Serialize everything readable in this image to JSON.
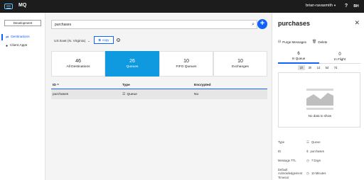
{
  "app": {
    "title": "MQ",
    "account": "brian-ravasmith",
    "avatar": "BH"
  },
  "sidebar": {
    "environment_button": "Development",
    "items": [
      {
        "label": "Destinations",
        "icon": "destinations-icon",
        "active": true
      },
      {
        "label": "Client Apps",
        "icon": "client-apps-icon",
        "active": false
      }
    ]
  },
  "main": {
    "search": {
      "value": "purchases"
    },
    "region": "US East (N. Virginia)",
    "copy_label": "copy",
    "tabs": [
      {
        "count": "46",
        "label": "All Destinations",
        "active": false
      },
      {
        "count": "26",
        "label": "Queues",
        "active": true
      },
      {
        "count": "10",
        "label": "FIFO Queues",
        "active": false
      },
      {
        "count": "10",
        "label": "Exchanges",
        "active": false
      }
    ],
    "table": {
      "headers": [
        "ID ^",
        "Type",
        "Encrypted"
      ],
      "rows": [
        {
          "id": "purchases",
          "type": "Queue",
          "encrypted": "No"
        }
      ]
    }
  },
  "detail": {
    "title": "purchases",
    "actions": {
      "purge": "Purge Messages",
      "delete": "Delete"
    },
    "tabs": [
      {
        "count": "6",
        "label": "In Queue",
        "active": true
      },
      {
        "count": "0",
        "label": "In Flight",
        "active": false
      }
    ],
    "time_ranges": [
      "1h",
      "3h",
      "1d",
      "5d",
      "7d"
    ],
    "active_range": "1h",
    "chart": {
      "empty_message": "No data to show"
    },
    "properties": [
      {
        "key": "Type",
        "value": "Queue",
        "icon": "queue-icon"
      },
      {
        "key": "ID",
        "value": "purchases",
        "icon": "dollar-icon"
      },
      {
        "key": "Message TTL",
        "value": "7 Days",
        "icon": "clock-icon"
      },
      {
        "key": "Default Acknowledgement Timeout",
        "value": "10 Minutes",
        "icon": "clock-icon"
      }
    ]
  },
  "colors": {
    "accent": "#0f62fe",
    "active_tab": "#0f9ae0",
    "topbar": "#1c1c1c"
  }
}
